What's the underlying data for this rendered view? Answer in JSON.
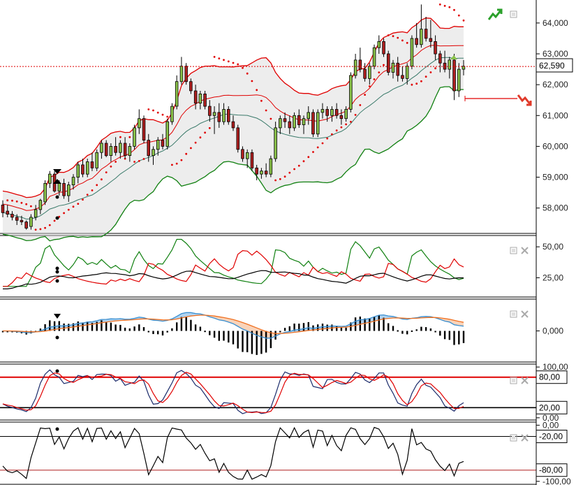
{
  "panes": [
    {
      "id": "price",
      "ticks": [
        "64,000",
        "63,000",
        "62,000",
        "61,000",
        "60,000",
        "59,000",
        "58,000"
      ],
      "tick_values": [
        64000,
        63000,
        62000,
        61000,
        60000,
        59000,
        58000
      ],
      "last_price_label": "62,590",
      "last_price": 62590,
      "y_range": [
        57200,
        64700
      ]
    },
    {
      "id": "dmi",
      "ticks": [
        "50,00",
        "25,00"
      ],
      "tick_values": [
        50,
        25
      ],
      "y_range": [
        10,
        58
      ]
    },
    {
      "id": "macd",
      "ticks": [
        "0,000"
      ],
      "tick_values": [
        0
      ],
      "y_range": [
        -3.2,
        3.2
      ]
    },
    {
      "id": "stoch",
      "ticks": [
        "100,00",
        "80,00",
        "20,00",
        "0,00"
      ],
      "tick_values": [
        100,
        80,
        20,
        0
      ],
      "levels": [
        "80,00",
        "20,00"
      ],
      "level_values": [
        80,
        20
      ],
      "y_range": [
        -3,
        103
      ]
    },
    {
      "id": "williams",
      "ticks": [
        "0,00",
        "-20,00",
        "-80,00",
        "-100,00"
      ],
      "tick_values": [
        0,
        -20,
        -80,
        -100
      ],
      "levels": [
        "-20,00",
        "-80,00"
      ],
      "level_values": [
        -20,
        -80
      ],
      "y_range": [
        -104,
        3
      ]
    }
  ],
  "icons": {
    "trend_up": "trend-up-icon",
    "trend_down": "trend-down-icon",
    "restore": "restore-icon",
    "close": "close-icon"
  },
  "colors": {
    "up_candle": "#8BC34A",
    "down_candle": "#B02020",
    "bollinger_outer_upper": "#E00000",
    "bollinger_outer_lower": "#108010",
    "sar": "#E00000",
    "plus_di": "#108010",
    "minus_di": "#E00000",
    "adx": "#000000",
    "macd": "#3A8FD0",
    "signal": "#F07020",
    "stoch_k": "#1A2A6A",
    "stoch_d": "#E00000",
    "level_line": "#E00000"
  },
  "chart_data": {
    "type": "candlestick",
    "candles": [
      [
        58100,
        58250,
        57700,
        57850
      ],
      [
        57900,
        58100,
        57700,
        57800
      ],
      [
        57800,
        57900,
        57600,
        57700
      ],
      [
        57700,
        57800,
        57450,
        57600
      ],
      [
        57600,
        57750,
        57450,
        57550
      ],
      [
        57550,
        57600,
        57300,
        57350
      ],
      [
        57400,
        57800,
        57300,
        57700
      ],
      [
        57700,
        58100,
        57600,
        57950
      ],
      [
        57950,
        58300,
        57800,
        58250
      ],
      [
        58200,
        58900,
        58100,
        58800
      ],
      [
        58800,
        59200,
        58650,
        59100
      ],
      [
        59100,
        59200,
        58500,
        58550
      ],
      [
        58550,
        58900,
        58400,
        58800
      ],
      [
        58800,
        58950,
        58300,
        58400
      ],
      [
        58400,
        58850,
        58200,
        58750
      ],
      [
        58750,
        59100,
        58600,
        59000
      ],
      [
        59000,
        59500,
        58800,
        59400
      ],
      [
        59400,
        59600,
        59000,
        59100
      ],
      [
        59100,
        59600,
        59000,
        59500
      ],
      [
        59500,
        59800,
        59200,
        59300
      ],
      [
        59300,
        59900,
        59200,
        59800
      ],
      [
        59800,
        60200,
        59600,
        60100
      ],
      [
        60100,
        60200,
        59650,
        59700
      ],
      [
        59700,
        60100,
        59500,
        60000
      ],
      [
        60000,
        60300,
        59700,
        59800
      ],
      [
        59800,
        60200,
        59600,
        60100
      ],
      [
        60100,
        60300,
        59600,
        59700
      ],
      [
        59700,
        60100,
        59500,
        60000
      ],
      [
        60000,
        60700,
        59900,
        60600
      ],
      [
        60600,
        61200,
        60400,
        60900
      ],
      [
        60900,
        61000,
        60100,
        60200
      ],
      [
        60200,
        60400,
        59500,
        59700
      ],
      [
        59700,
        60000,
        59400,
        59900
      ],
      [
        59900,
        60300,
        59700,
        60200
      ],
      [
        60200,
        60400,
        59900,
        60000
      ],
      [
        60000,
        60900,
        59900,
        60800
      ],
      [
        60800,
        61400,
        60700,
        61300
      ],
      [
        61300,
        62300,
        61200,
        62100
      ],
      [
        62100,
        62900,
        62000,
        62600
      ],
      [
        62600,
        62700,
        62000,
        62100
      ],
      [
        62100,
        62200,
        61700,
        61800
      ],
      [
        61800,
        62000,
        61200,
        61400
      ],
      [
        61400,
        61800,
        61200,
        61700
      ],
      [
        61700,
        61800,
        61200,
        61300
      ],
      [
        61300,
        61500,
        60800,
        61000
      ],
      [
        61000,
        61300,
        60400,
        61100
      ],
      [
        61100,
        61400,
        60600,
        60800
      ],
      [
        60800,
        61400,
        60700,
        61200
      ],
      [
        61200,
        61300,
        60700,
        60800
      ],
      [
        60800,
        61000,
        60500,
        60600
      ],
      [
        60600,
        60700,
        59800,
        59900
      ],
      [
        59900,
        60000,
        59500,
        59600
      ],
      [
        59600,
        59900,
        59300,
        59800
      ],
      [
        59800,
        59900,
        59200,
        59300
      ],
      [
        59300,
        59400,
        58900,
        59100
      ],
      [
        59100,
        59300,
        58950,
        59200
      ],
      [
        59200,
        59450,
        59000,
        59100
      ],
      [
        59100,
        59700,
        59000,
        59600
      ],
      [
        59600,
        60800,
        59500,
        60600
      ],
      [
        60600,
        61000,
        60400,
        60900
      ],
      [
        60900,
        61100,
        60600,
        60800
      ],
      [
        60800,
        61000,
        60400,
        60600
      ],
      [
        60600,
        61100,
        60500,
        61000
      ],
      [
        61000,
        61200,
        60600,
        60700
      ],
      [
        60700,
        61000,
        60400,
        60900
      ],
      [
        60900,
        61300,
        60700,
        61100
      ],
      [
        61100,
        61200,
        60300,
        60400
      ],
      [
        60400,
        61200,
        60300,
        61100
      ],
      [
        61100,
        61400,
        60900,
        61200
      ],
      [
        61200,
        61300,
        60800,
        61000
      ],
      [
        61000,
        61300,
        60800,
        61200
      ],
      [
        61200,
        61400,
        60900,
        61000
      ],
      [
        61000,
        61200,
        60700,
        60900
      ],
      [
        60900,
        61300,
        60800,
        61200
      ],
      [
        61200,
        62400,
        61100,
        62300
      ],
      [
        62300,
        63000,
        62200,
        62800
      ],
      [
        62800,
        63200,
        62400,
        62500
      ],
      [
        62500,
        62700,
        62100,
        62200
      ],
      [
        62200,
        62700,
        62000,
        62600
      ],
      [
        62600,
        63300,
        62500,
        63200
      ],
      [
        63200,
        63600,
        63000,
        63400
      ],
      [
        63400,
        63500,
        62900,
        63000
      ],
      [
        63000,
        63100,
        62300,
        62400
      ],
      [
        62400,
        62800,
        62200,
        62700
      ],
      [
        62700,
        62900,
        62100,
        62300
      ],
      [
        62300,
        62600,
        62100,
        62200
      ],
      [
        62200,
        62700,
        62000,
        62600
      ],
      [
        62600,
        63600,
        62500,
        63500
      ],
      [
        63500,
        64000,
        63200,
        63300
      ],
      [
        63300,
        64600,
        63200,
        63800
      ],
      [
        63800,
        64200,
        63400,
        63500
      ],
      [
        63500,
        64100,
        63200,
        63400
      ],
      [
        63400,
        63600,
        62800,
        63000
      ],
      [
        63000,
        63100,
        62400,
        62700
      ],
      [
        62700,
        63100,
        62400,
        62500
      ],
      [
        62500,
        62900,
        62200,
        62800
      ],
      [
        62800,
        63000,
        61500,
        61800
      ],
      [
        61800,
        62700,
        61600,
        62500
      ],
      [
        62500,
        62800,
        62300,
        62600
      ]
    ]
  }
}
